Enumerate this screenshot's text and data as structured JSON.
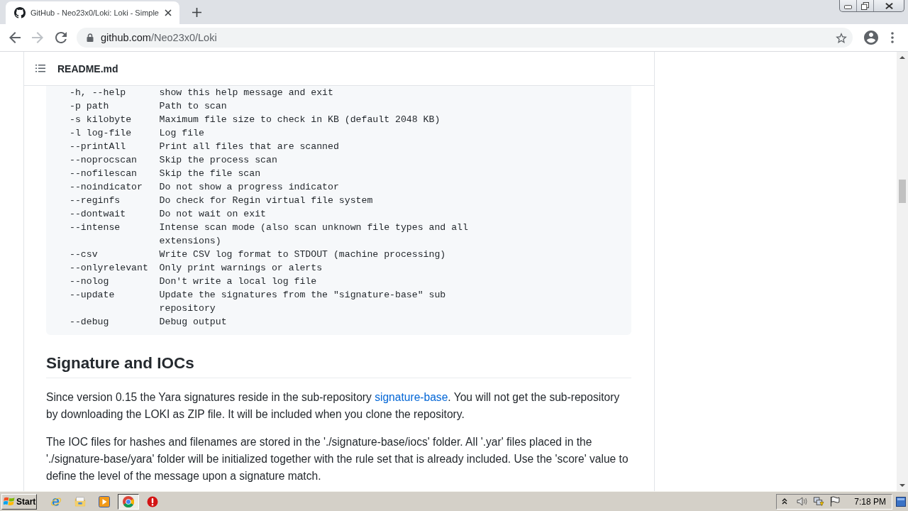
{
  "browser": {
    "tab": {
      "title": "GitHub - Neo23x0/Loki: Loki - Simple",
      "selected": true
    },
    "nav": {
      "forward": {
        "disabled": true
      }
    },
    "address": {
      "host": "github.com",
      "path": "/Neo23x0/Loki"
    }
  },
  "readme": {
    "file_name": "README.md"
  },
  "code_block": {
    "rows": [
      {
        "option": "-h, --help",
        "description": "show this help message and exit"
      },
      {
        "option": "-p path",
        "description": "Path to scan"
      },
      {
        "option": "-s kilobyte",
        "description": "Maximum file size to check in KB (default 2048 KB)"
      },
      {
        "option": "-l log-file",
        "description": "Log file"
      },
      {
        "option": "--printAll",
        "description": "Print all files that are scanned"
      },
      {
        "option": "--noprocscan",
        "description": "Skip the process scan"
      },
      {
        "option": "--nofilescan",
        "description": "Skip the file scan"
      },
      {
        "option": "--noindicator",
        "description": "Do not show a progress indicator"
      },
      {
        "option": "--reginfs",
        "description": "Do check for Regin virtual file system"
      },
      {
        "option": "--dontwait",
        "description": "Do not wait on exit"
      },
      {
        "option": "--intense",
        "description": "Intense scan mode (also scan unknown file types and all extensions)"
      },
      {
        "option": "--csv",
        "description": "Write CSV log format to STDOUT (machine processing)"
      },
      {
        "option": "--onlyrelevant",
        "description": "Only print warnings or alerts"
      },
      {
        "option": "--nolog",
        "description": "Don't write a local log file"
      },
      {
        "option": "--update",
        "description": "Update the signatures from the \"signature-base\" sub repository"
      },
      {
        "option": "--debug",
        "description": "Debug output"
      }
    ]
  },
  "section": {
    "heading": "Signature and IOCs",
    "paragraphs": [
      {
        "parts": [
          {
            "kind": "text",
            "text": "Since version 0.15 the Yara signatures reside in the sub-repository "
          },
          {
            "kind": "link",
            "text": "signature-base"
          },
          {
            "kind": "text",
            "text": ". You will not get the sub-repository by downloading the LOKI as ZIP file. It will be included when you clone the repository."
          }
        ]
      },
      {
        "parts": [
          {
            "kind": "text",
            "text": "The IOC files for hashes and filenames are stored in the './signature-base/iocs' folder. All '.yar' files placed in the './signature-base/yara' folder will be initialized together with the rule set that is already included. Use the 'score' value to define the level of the message upon a signature match."
          }
        ]
      }
    ]
  },
  "taskbar": {
    "start": "Start",
    "apps": [
      {
        "kind": "e-browser",
        "active": false
      },
      {
        "kind": "folder",
        "active": false
      },
      {
        "kind": "media-player",
        "active": false
      },
      {
        "kind": "ring-browser",
        "active": true
      },
      {
        "kind": "alert",
        "active": false
      }
    ],
    "clock": "7:18 PM"
  }
}
